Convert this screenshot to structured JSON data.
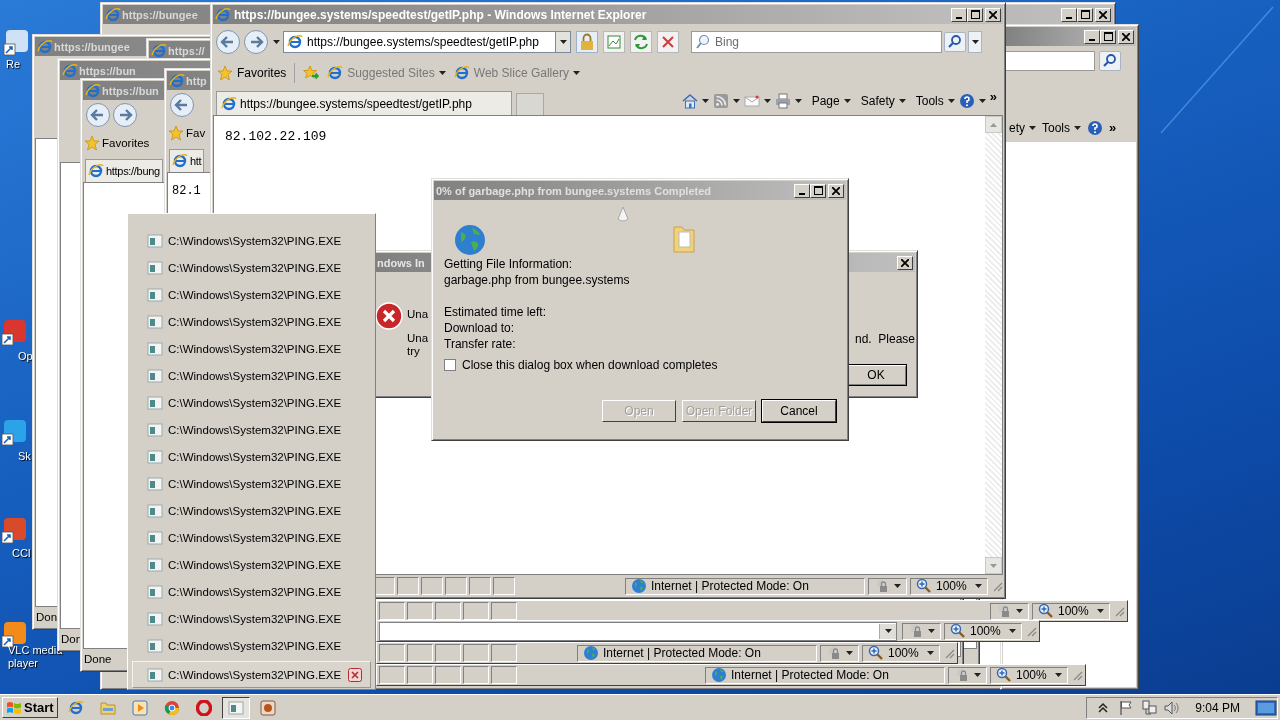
{
  "desktop": {
    "icons": [
      {
        "label": "Re"
      },
      {
        "label": "Op"
      },
      {
        "label": "Sk"
      },
      {
        "label": "CCl"
      },
      {
        "label": "VLC media player"
      }
    ]
  },
  "background_windows": [
    {
      "kind": "title",
      "title": "https://bungee"
    },
    {
      "kind": "toolbar",
      "toolbar": [
        "ety",
        "Tools"
      ],
      "overflow": "»"
    },
    {
      "kind": "stack",
      "title": "https://bungee",
      "status": "Don"
    },
    {
      "kind": "stack",
      "title": "https://"
    },
    {
      "kind": "stack",
      "title": "https://bun",
      "status": "Don"
    },
    {
      "kind": "browser",
      "title": "https://bun",
      "favorites": "Favorites",
      "tab": "https://bung",
      "status": "Done"
    },
    {
      "kind": "narrow",
      "title": "http",
      "favorites": "Fav",
      "tab": "htt",
      "page_text": "82.1"
    }
  ],
  "status_bars": [
    {
      "kind": "status",
      "zoom": "100%"
    },
    {
      "kind": "field",
      "zoom": "100%"
    },
    {
      "kind": "status",
      "zone": "Internet | Protected Mode: On",
      "zoom": "100%"
    },
    {
      "kind": "status",
      "zone": "Internet | Protected Mode: On",
      "zoom": "100%"
    }
  ],
  "main_window": {
    "title": "https://bungee.systems/speedtest/getIP.php - Windows Internet Explorer",
    "address": "https://bungee.systems/speedtest/getIP.php",
    "search_placeholder": "Bing",
    "favorites_label": "Favorites",
    "favorites_links": [
      "Suggested Sites",
      "Web Slice Gallery"
    ],
    "tab": "https://bungee.systems/speedtest/getIP.php",
    "command_menus": [
      "Page",
      "Safety",
      "Tools"
    ],
    "overflow": "»",
    "page_text": "82.102.22.109",
    "status": {
      "zone": "Internet | Protected Mode: On",
      "zoom": "100%"
    }
  },
  "error_dialog": {
    "title": "ndows In",
    "heading": "Una",
    "message_lines": [
      "Una",
      "try"
    ],
    "message_end": "nd.  Please",
    "ok": "OK"
  },
  "download_dialog": {
    "title": "0% of garbage.php from bungee.systems Completed",
    "status": "Getting File Information:",
    "file": "garbage.php from bungee.systems",
    "fields": [
      "Estimated time left:",
      "Download to:",
      "Transfer rate:"
    ],
    "close_when_done": {
      "label": "Close this dialog box when download completes",
      "checked": false
    },
    "buttons": [
      {
        "label": "Open",
        "disabled": true
      },
      {
        "label": "Open Folder",
        "disabled": true
      },
      {
        "label": "Cancel",
        "disabled": false
      }
    ]
  },
  "ping_list": {
    "items": [
      {
        "label": "C:\\Windows\\System32\\PING.EXE",
        "selected": false
      },
      {
        "label": "C:\\Windows\\System32\\PING.EXE",
        "selected": false
      },
      {
        "label": "C:\\Windows\\System32\\PING.EXE",
        "selected": false
      },
      {
        "label": "C:\\Windows\\System32\\PING.EXE",
        "selected": false
      },
      {
        "label": "C:\\Windows\\System32\\PING.EXE",
        "selected": false
      },
      {
        "label": "C:\\Windows\\System32\\PING.EXE",
        "selected": false
      },
      {
        "label": "C:\\Windows\\System32\\PING.EXE",
        "selected": false
      },
      {
        "label": "C:\\Windows\\System32\\PING.EXE",
        "selected": false
      },
      {
        "label": "C:\\Windows\\System32\\PING.EXE",
        "selected": false
      },
      {
        "label": "C:\\Windows\\System32\\PING.EXE",
        "selected": false
      },
      {
        "label": "C:\\Windows\\System32\\PING.EXE",
        "selected": false
      },
      {
        "label": "C:\\Windows\\System32\\PING.EXE",
        "selected": false
      },
      {
        "label": "C:\\Windows\\System32\\PING.EXE",
        "selected": false
      },
      {
        "label": "C:\\Windows\\System32\\PING.EXE",
        "selected": false
      },
      {
        "label": "C:\\Windows\\System32\\PING.EXE",
        "selected": false
      },
      {
        "label": "C:\\Windows\\System32\\PING.EXE",
        "selected": false
      },
      {
        "label": "C:\\Windows\\System32\\PING.EXE",
        "selected": true
      }
    ]
  },
  "taskbar": {
    "start": "Start",
    "apps": [
      {
        "kind": "browser",
        "selected": false
      },
      {
        "kind": "folder",
        "selected": false
      },
      {
        "kind": "media",
        "selected": false
      },
      {
        "kind": "chrome",
        "selected": false
      },
      {
        "kind": "opera",
        "selected": false
      },
      {
        "kind": "window",
        "selected": true
      },
      {
        "kind": "app",
        "selected": false
      }
    ],
    "clock": "9:04 PM"
  }
}
